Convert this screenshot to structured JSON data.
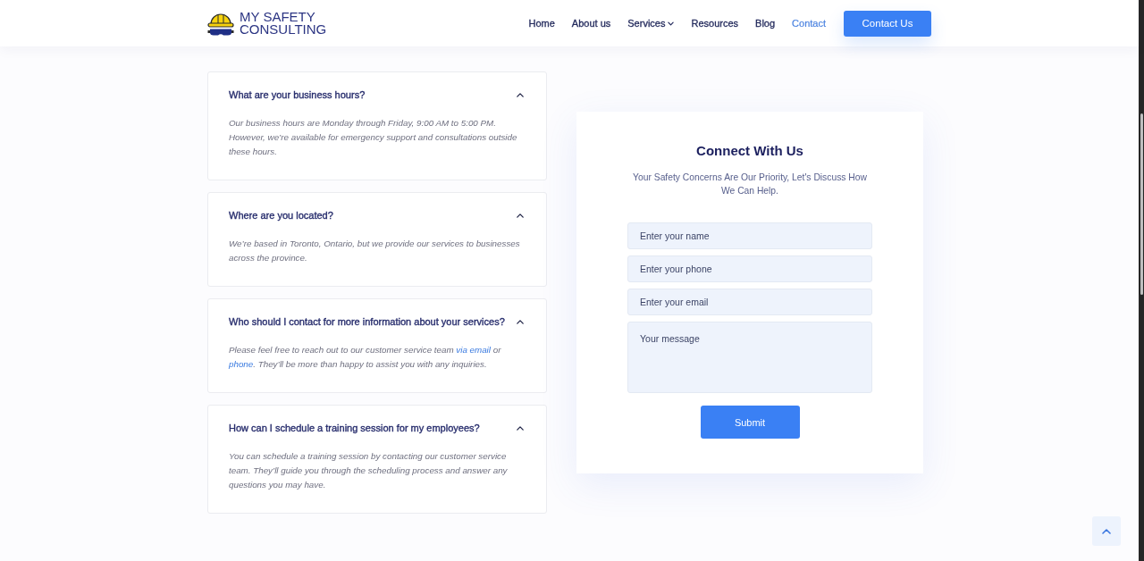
{
  "header": {
    "logo": {
      "lines": [
        "MY SAFETY",
        "CONSULTING"
      ]
    },
    "nav": [
      {
        "label": "Home",
        "selected": false,
        "dropdown": false
      },
      {
        "label": "About us",
        "selected": false,
        "dropdown": false
      },
      {
        "label": "Services",
        "selected": false,
        "dropdown": true
      },
      {
        "label": "Resources",
        "selected": false,
        "dropdown": false
      },
      {
        "label": "Blog",
        "selected": false,
        "dropdown": false
      },
      {
        "label": "Contact",
        "selected": true,
        "dropdown": false
      }
    ],
    "cta": "Contact Us"
  },
  "faq": [
    {
      "question": "What are your business hours?",
      "expanded": true,
      "answer": [
        {
          "kind": "text",
          "text": "Our business hours are Monday through Friday, 9:00 AM to 5:00 PM. However, we’re available for emergency support and consultations outside these hours."
        }
      ]
    },
    {
      "question": "Where are you located?",
      "expanded": true,
      "answer": [
        {
          "kind": "text",
          "text": "We’re based in Toronto, Ontario, but we provide our services to businesses across the province."
        }
      ]
    },
    {
      "question": "Who should I contact for more information about your services?",
      "expanded": true,
      "answer": [
        {
          "kind": "text",
          "text": "Please feel free to reach out to our customer service team "
        },
        {
          "kind": "link",
          "text": "via email"
        },
        {
          "kind": "text",
          "text": " or "
        },
        {
          "kind": "link",
          "text": "phone"
        },
        {
          "kind": "text",
          "text": ". They’ll be more than happy to assist you with any inquiries."
        }
      ]
    },
    {
      "question": "How can I schedule a training session for my employees?",
      "expanded": true,
      "answer": [
        {
          "kind": "text",
          "text": "You can schedule a training session by contacting our customer service team. They’ll guide you through the scheduling process and answer any questions you may have."
        }
      ]
    }
  ],
  "contact_form": {
    "title": "Connect With Us",
    "subtitle": "Your Safety Concerns Are Our Priority, Let's Discuss How We Can Help.",
    "fields": [
      {
        "kind": "input",
        "placeholder": "Enter your name"
      },
      {
        "kind": "input",
        "placeholder": "Enter your phone"
      },
      {
        "kind": "input",
        "placeholder": "Enter your email"
      },
      {
        "kind": "textarea",
        "placeholder": "Your message"
      }
    ],
    "submit": "Submit"
  }
}
